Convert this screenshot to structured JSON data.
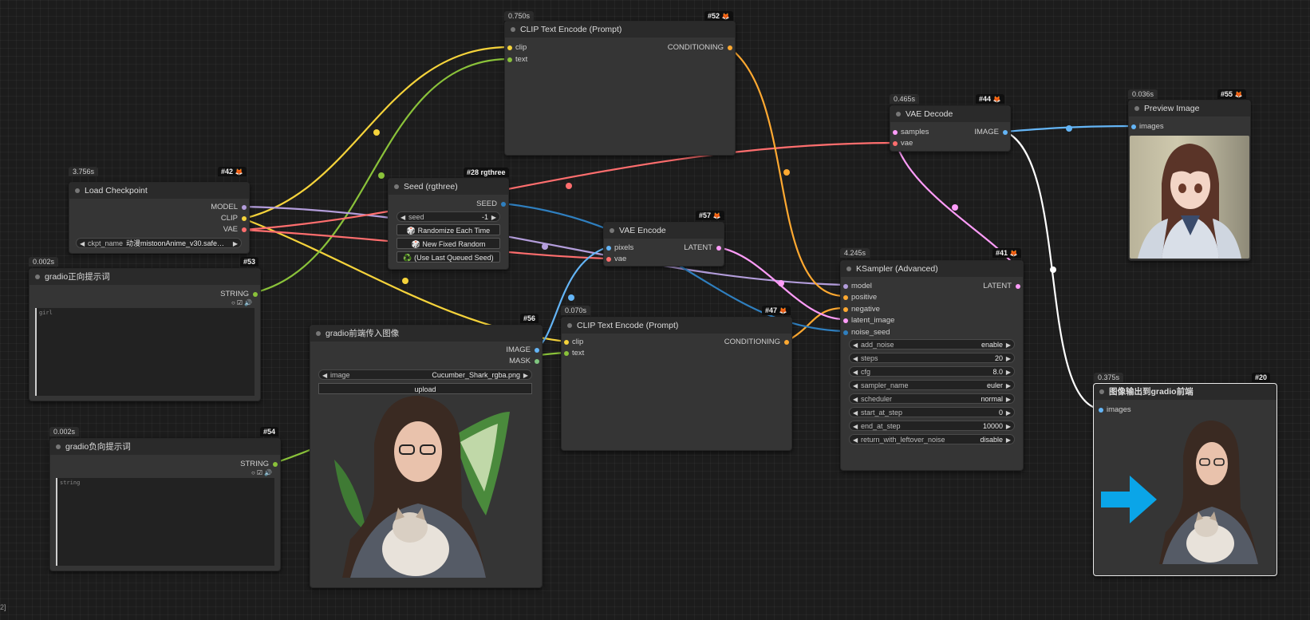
{
  "colors": {
    "clip": "#f5d33b",
    "string": "#8ac23a",
    "model": "#b39ddb",
    "vae": "#ff6e6e",
    "image": "#64b5f6",
    "latent": "#ff9cf9",
    "conditioning": "#ffa931",
    "int": "#2f7fbf",
    "wire_white": "#ffffff",
    "mask": "#7fc67f"
  },
  "nodes": {
    "clip52": {
      "time": "0.750s",
      "id": "#52",
      "title": "CLIP Text Encode (Prompt)",
      "in1": "clip",
      "in2": "text",
      "out1": "CONDITIONING"
    },
    "vaedecode44": {
      "time": "0.465s",
      "id": "#44",
      "title": "VAE Decode",
      "in1": "samples",
      "in2": "vae",
      "out1": "IMAGE"
    },
    "preview55": {
      "time": "0.036s",
      "id": "#55",
      "title": "Preview Image",
      "in1": "images"
    },
    "checkpoint42": {
      "time": "3.756s",
      "id": "#42",
      "title": "Load Checkpoint",
      "out1": "MODEL",
      "out2": "CLIP",
      "out3": "VAE",
      "w_label": "ckpt_name",
      "w_value": "动漫mistoonAnime_v30.safe…"
    },
    "seed28": {
      "id": "#28 rgthree",
      "title": "Seed (rgthree)",
      "out1": "SEED",
      "w_label": "seed",
      "w_value": "-1",
      "b1": "🎲 Randomize Each Time",
      "b2": "🎲 New Fixed Random",
      "b3": "♻️ (Use Last Queued Seed)"
    },
    "vaeencode57": {
      "id": "#57",
      "title": "VAE Encode",
      "in1": "pixels",
      "in2": "vae",
      "out1": "LATENT"
    },
    "ksampler41": {
      "time": "4.245s",
      "id": "#41",
      "title": "KSampler (Advanced)",
      "in1": "model",
      "in2": "positive",
      "in3": "negative",
      "in4": "latent_image",
      "in5": "noise_seed",
      "out1": "LATENT",
      "widgets": [
        {
          "label": "add_noise",
          "value": "enable"
        },
        {
          "label": "steps",
          "value": "20"
        },
        {
          "label": "cfg",
          "value": "8.0"
        },
        {
          "label": "sampler_name",
          "value": "euler"
        },
        {
          "label": "scheduler",
          "value": "normal"
        },
        {
          "label": "start_at_step",
          "value": "0"
        },
        {
          "label": "end_at_step",
          "value": "10000"
        },
        {
          "label": "return_with_leftover_noise",
          "value": "disable"
        }
      ]
    },
    "pos53": {
      "time": "0.002s",
      "id": "#53",
      "title": "gradio正向提示词",
      "out1": "STRING",
      "text": "girl"
    },
    "neg54": {
      "time": "0.002s",
      "id": "#54",
      "title": "gradio负向提示词",
      "out1": "STRING",
      "text": "string"
    },
    "img56": {
      "id": "#56",
      "title": "gradio前端传入图像",
      "out1": "IMAGE",
      "out2": "MASK",
      "w_label": "image",
      "w_value": "Cucumber_Shark_rgba.png",
      "upload": "upload"
    },
    "clip47": {
      "time": "0.070s",
      "id": "#47",
      "title": "CLIP Text Encode (Prompt)",
      "in1": "clip",
      "in2": "text",
      "out1": "CONDITIONING"
    },
    "out20": {
      "time": "0.375s",
      "id": "#20",
      "title": "图像输出到gradio前端",
      "in1": "images"
    }
  },
  "corner_label": "2]"
}
